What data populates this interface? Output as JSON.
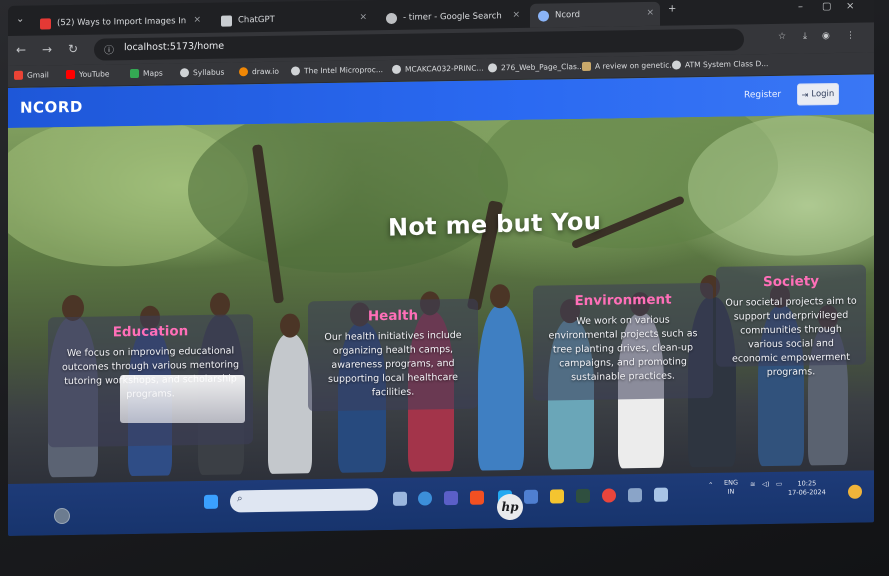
{
  "browser": {
    "tabs": [
      {
        "label": "(52) Ways to Import Images In",
        "close": "×"
      },
      {
        "label": "ChatGPT",
        "close": "×"
      },
      {
        "label": "- timer - Google Search",
        "close": "×"
      },
      {
        "label": "Ncord",
        "close": "×"
      }
    ],
    "new_tab": "+",
    "window_controls": {
      "minimize": "–",
      "maximize": "▢",
      "close": "×"
    },
    "url": "localhost:5173/home",
    "bookmarks": [
      "Gmail",
      "YouTube",
      "Maps",
      "Syllabus",
      "draw.io",
      "The Intel Microproc...",
      "MCAKCA032-PRINC...",
      "276_Web_Page_Clas...",
      "A review on genetic...",
      "ATM System Class D..."
    ]
  },
  "site": {
    "brand": "NCORD",
    "nav": {
      "register": "Register",
      "login": "Login"
    },
    "hero_title": "Not me but You",
    "cards": [
      {
        "title": "Education",
        "text": "We focus on improving educational outcomes through various mentoring tutoring workshops, and scholarship programs."
      },
      {
        "title": "Health",
        "text": "Our health initiatives include organizing health camps, awareness programs, and supporting local healthcare facilities."
      },
      {
        "title": "Environment",
        "text": "We work on various environmental projects such as tree planting drives, clean-up campaigns, and promoting sustainable practices."
      },
      {
        "title": "Society",
        "text": "Our societal projects aim to support underprivileged communities through various social and economic empowerment programs."
      }
    ]
  },
  "taskbar": {
    "language": "ENG",
    "region": "IN",
    "time": "10:25",
    "date": "17-06-2024"
  },
  "colors": {
    "navbar": "#2b6af2",
    "card_title": "#ff6fb8",
    "taskbar": "#1e3b78"
  }
}
